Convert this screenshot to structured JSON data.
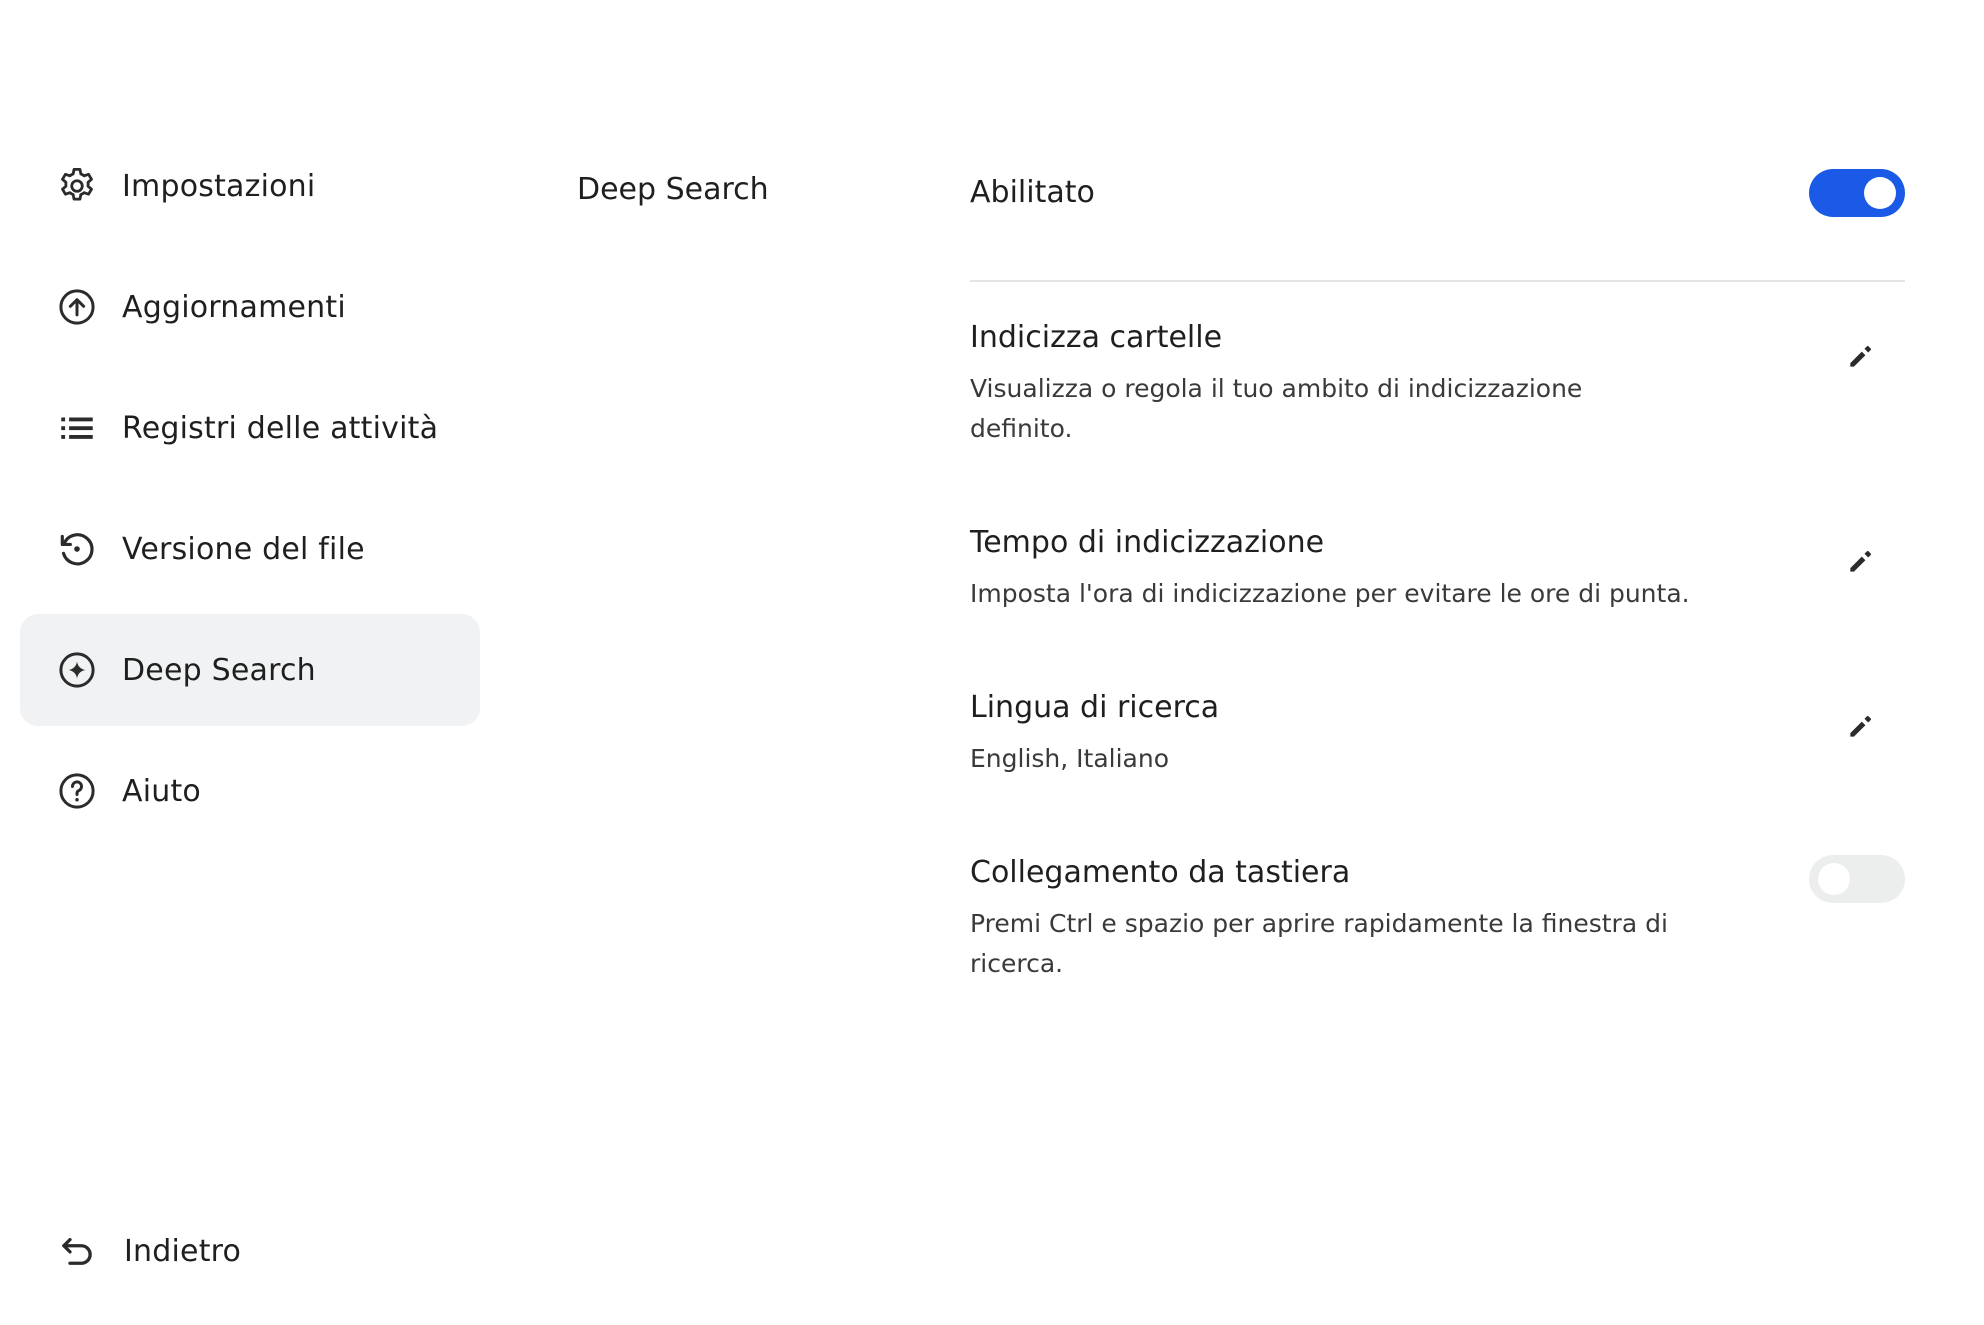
{
  "sidebar": {
    "items": [
      {
        "label": "Impostazioni",
        "icon": "gear-icon"
      },
      {
        "label": "Aggiornamenti",
        "icon": "upload-circle-icon"
      },
      {
        "label": "Registri delle attività",
        "icon": "list-icon"
      },
      {
        "label": "Versione del file",
        "icon": "history-icon"
      },
      {
        "label": "Deep Search",
        "icon": "sparkle-circle-icon",
        "active": true
      },
      {
        "label": "Aiuto",
        "icon": "help-circle-icon"
      }
    ],
    "back_label": "Indietro"
  },
  "section_title": "Deep Search",
  "content": {
    "enabled_label": "Abilitato",
    "enabled_state": true,
    "settings": [
      {
        "title": "Indicizza cartelle",
        "description": "Visualizza o regola il tuo ambito di indicizzazione definito.",
        "action": "edit"
      },
      {
        "title": "Tempo di indicizzazione",
        "description": "Imposta l'ora di indicizzazione per evitare le ore di punta.",
        "action": "edit"
      },
      {
        "title": "Lingua di ricerca",
        "description": "English, Italiano",
        "action": "edit"
      },
      {
        "title": "Collegamento da tastiera",
        "description": "Premi Ctrl e spazio per aprire rapidamente la finestra di ricerca.",
        "action": "toggle",
        "state": false
      }
    ]
  },
  "colors": {
    "accent": "#1a5ae6",
    "active_bg": "#f1f2f3",
    "toggle_off": "#eceded",
    "divider": "#e3e4e5"
  }
}
